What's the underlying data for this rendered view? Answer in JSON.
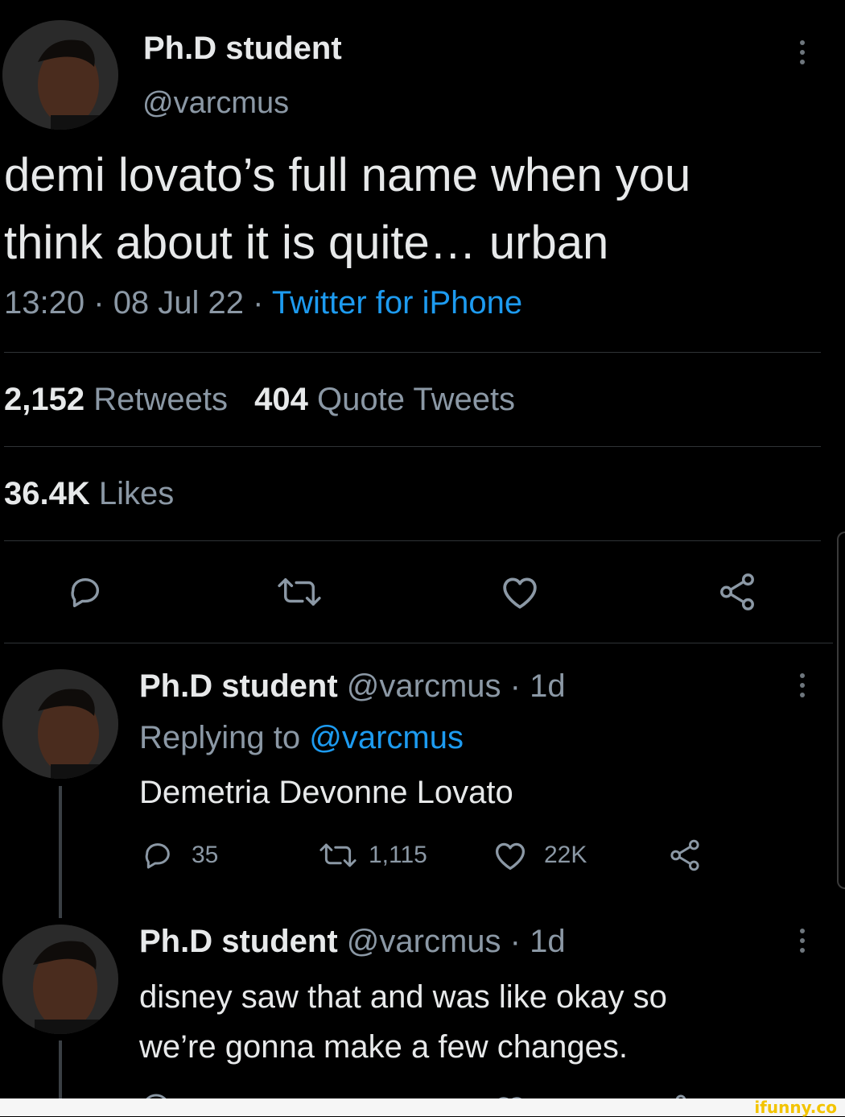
{
  "main_tweet": {
    "display_name": "Ph.D student",
    "handle": "@varcmus",
    "text_line1": "demi lovato’s full name when you",
    "text_line2": "think about it is quite… urban",
    "time": "13:20",
    "sep1": "·",
    "date": "08 Jul 22",
    "sep2": "·",
    "source": "Twitter for iPhone",
    "retweets_count": "2,152",
    "retweets_label": "Retweets",
    "quotes_count": "404",
    "quotes_label": "Quote Tweets",
    "likes_count": "36.4K",
    "likes_label": "Likes",
    "action_icons": [
      "reply-icon",
      "retweet-icon",
      "like-icon",
      "share-icon"
    ]
  },
  "reply1": {
    "display_name": "Ph.D student",
    "handle": "@varcmus",
    "sep": "·",
    "age": "1d",
    "replying_prefix": "Replying to",
    "replying_handle": "@varcmus",
    "text": "Demetria Devonne Lovato",
    "reply_count": "35",
    "retweet_count": "1,115",
    "like_count": "22K"
  },
  "reply2": {
    "display_name": "Ph.D student",
    "handle": "@varcmus",
    "sep": "·",
    "age": "1d",
    "text_line1": "disney saw that and was like okay so",
    "text_line2": "we’re gonna make a few changes."
  },
  "watermark": {
    "text": "ifunny.co"
  },
  "colors": {
    "background": "#000000",
    "text": "#e7e9ea",
    "secondary": "#8b98a5",
    "link": "#1d9bf0",
    "divider": "#2f3336",
    "watermark": "#f3c400"
  }
}
